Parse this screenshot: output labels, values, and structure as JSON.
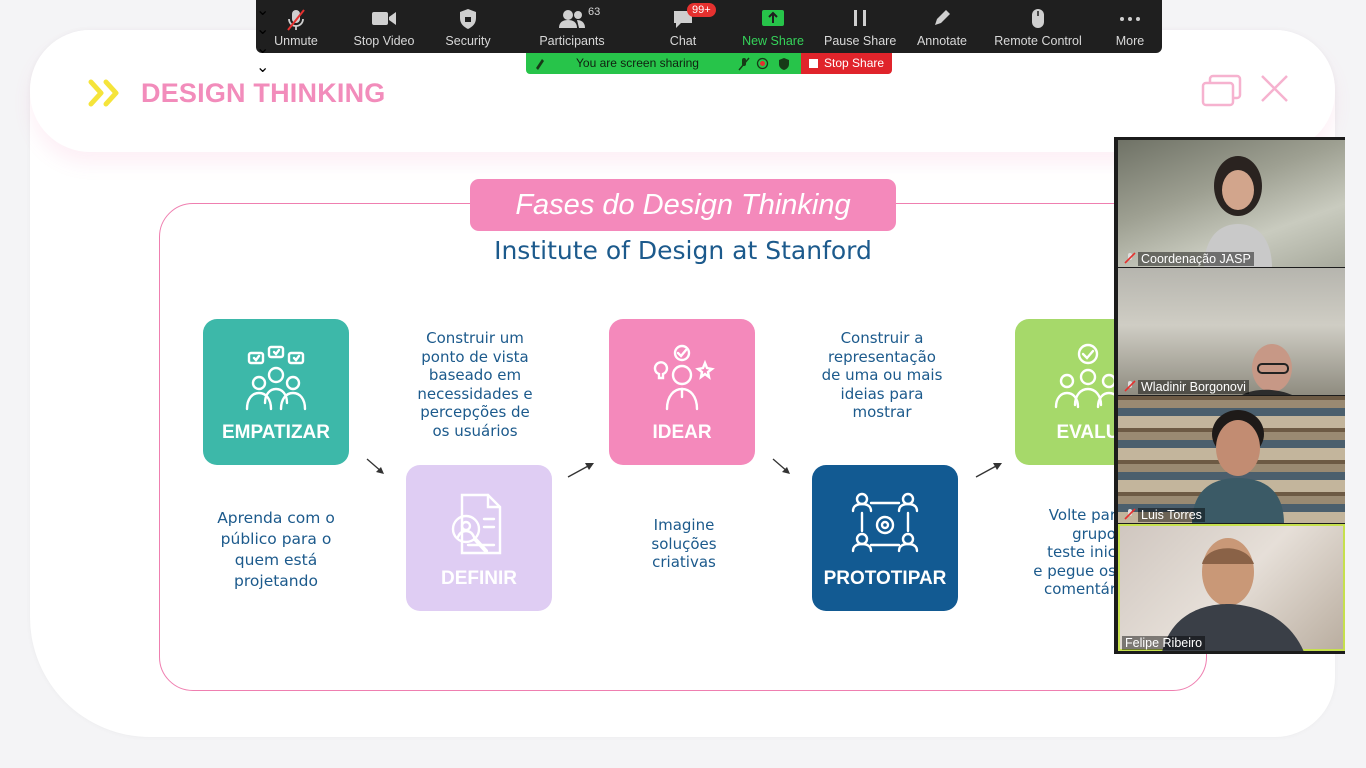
{
  "slide": {
    "title": "DESIGN THINKING",
    "phases_banner": "Fases do Design Thinking",
    "subtitle": "Institute of Design at Stanford",
    "tiles": {
      "empatizar": "EMPATIZAR",
      "definir": "DEFINIR",
      "idear": "IDEAR",
      "prototipar": "PROTOTIPAR",
      "evaluar": "EVALU"
    },
    "descriptions": {
      "empatizar": [
        "Aprenda com o",
        "público para o",
        "quem está",
        "projetando"
      ],
      "definir": [
        "Construir um",
        "ponto de vista",
        "baseado em",
        "necessidades e",
        "percepções de",
        "os usuários"
      ],
      "idear": [
        "Imagine",
        "soluções",
        "criativas"
      ],
      "prototipar": [
        "Construir a",
        "representação",
        "de uma ou mais",
        "ideias para",
        "mostrar"
      ],
      "evaluar": [
        "Volte par",
        "grupo",
        "teste inic",
        "e pegue os",
        "comentár"
      ]
    },
    "colors": {
      "title_pink": "#f28cbb",
      "empatizar": "#3db8a9",
      "definir": "#dfcdf3",
      "idear": "#f489bb",
      "prototipar": "#125a92",
      "evaluar": "#a6d96a",
      "text_blue": "#1c5a8c"
    }
  },
  "toolbar": {
    "unmute": "Unmute",
    "stop_video": "Stop Video",
    "security": "Security",
    "participants": "Participants",
    "participants_count": "63",
    "chat": "Chat",
    "chat_badge": "99+",
    "new_share": "New Share",
    "pause_share": "Pause Share",
    "annotate": "Annotate",
    "remote_control": "Remote Control",
    "more": "More"
  },
  "share_status": {
    "text": "You are screen sharing",
    "stop_label": "Stop Share"
  },
  "participants": [
    {
      "name": "Coordenação JASP",
      "muted": true
    },
    {
      "name": "Wladinir Borgonovi",
      "muted": true
    },
    {
      "name": "Luis Torres",
      "muted": true
    },
    {
      "name": "Felipe Ribeiro",
      "muted": false,
      "active_speaker": true
    }
  ]
}
